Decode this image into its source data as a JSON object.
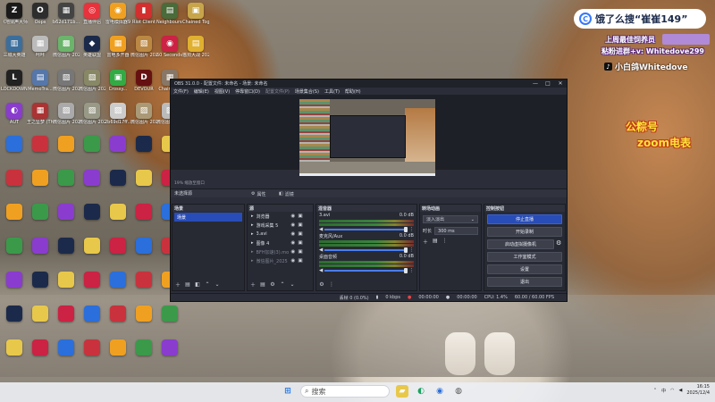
{
  "desktop": {
    "icons": [
      {
        "label": "《地狱声大师》",
        "glyph": "Z",
        "color": "#1a1a1a"
      },
      {
        "label": "Oops",
        "glyph": "O",
        "color": "#2d2d2d"
      },
      {
        "label": "b62d171b...",
        "glyph": "▦",
        "color": "#444"
      },
      {
        "label": "直播伴侣",
        "glyph": "◎",
        "color": "#e8323c"
      },
      {
        "label": "雷电模拟器9",
        "glyph": "◉",
        "color": "#f0a020"
      },
      {
        "label": "Riot Client",
        "glyph": "▮",
        "color": "#d32f2f"
      },
      {
        "label": "Neighbours back From...",
        "glyph": "▤",
        "color": "#4a6b3a"
      },
      {
        "label": "Chained Together",
        "glyph": "▣",
        "color": "#c7a54a"
      },
      {
        "label": "三城大英雄",
        "glyph": "▥",
        "color": "#3c6e9c"
      },
      {
        "label": "咔咔",
        "glyph": "▦",
        "color": "#bbb"
      },
      {
        "label": "微信图片 2025-08...",
        "glyph": "▩",
        "color": "#6bb46b"
      },
      {
        "label": "英雄联盟",
        "glyph": "◆",
        "color": "#1b2a4a"
      },
      {
        "label": "雷电多开器",
        "glyph": "▦",
        "color": "#f0a020"
      },
      {
        "label": "微信图片 2025101...",
        "glyph": "▧",
        "color": "#b84"
      },
      {
        "label": "60 Seconds! Reatomized",
        "glyph": "◉",
        "color": "#c24"
      },
      {
        "label": "猫狗大战 2025090...",
        "glyph": "▤",
        "color": "#e0b030"
      },
      {
        "label": "LOCKDOWN Protocol",
        "glyph": "L",
        "color": "#222"
      },
      {
        "label": "MemoTra...",
        "glyph": "▤",
        "color": "#5577aa"
      },
      {
        "label": "微信图片 20250...",
        "glyph": "▧",
        "color": "#777"
      },
      {
        "label": "微信图片 20250...",
        "glyph": "▧",
        "color": "#886"
      },
      {
        "label": "Crossy...",
        "glyph": "▣",
        "color": "#3a4"
      },
      {
        "label": "DEVOUR",
        "glyph": "D",
        "color": "#611"
      },
      {
        "label": "Chained...",
        "glyph": "▦",
        "color": "#876"
      },
      {
        "label": "",
        "glyph": "",
        "color": "#0000"
      },
      {
        "label": "AUT",
        "glyph": "◐",
        "color": "#8a3ccf"
      },
      {
        "label": "王之坠梦 (The King...",
        "glyph": "▦",
        "color": "#a33"
      },
      {
        "label": "微信图片 2025091...",
        "glyph": "▨",
        "color": "#aaa"
      },
      {
        "label": "微信图片 2025091...",
        "glyph": "▨",
        "color": "#998"
      },
      {
        "label": "2b69d17ff...",
        "glyph": "▨",
        "color": "#ccc"
      },
      {
        "label": "微信图片 20250...",
        "glyph": "▨",
        "color": "#a97"
      },
      {
        "label": "微信图片 20250...",
        "glyph": "▨",
        "color": "#bbb"
      },
      {
        "label": "微信图片 20250...",
        "glyph": "▨",
        "color": "#999"
      }
    ],
    "overlays": {
      "baidu_text": "饿了么搜“崔崔149”",
      "baidu_logo": "C",
      "promo_line1": "上周最佳饲养员",
      "promo_line2": "粘粉进群+v: Whitedove299",
      "douyin_id": "小白鸽Whitedove",
      "douyin_logo": "♪",
      "gzh_line1": "公粽号",
      "gzh_line2": "zoom电表"
    }
  },
  "obs": {
    "title": "OBS 31.0.0 - 配置文件: 未命名 - 场景: 未命名",
    "window_controls": [
      "—",
      "□",
      "✕"
    ],
    "menu": [
      "文件(F)",
      "编辑(E)",
      "视图(V)",
      "停靠窗口(D)",
      "配置文件(P)",
      "场景集合(S)",
      "工具(T)",
      "帮助(H)"
    ],
    "zoom_text": "19%  缩放至窗口",
    "source_bar": {
      "none_selected": "未选择源",
      "properties": "属性",
      "filters": "滤镜"
    },
    "scenes": {
      "header": "场景",
      "items": [
        "场景"
      ]
    },
    "sources": {
      "header": "源",
      "items": [
        {
          "name": "浏览器",
          "dim": false
        },
        {
          "name": "游戏采集 5",
          "dim": false
        },
        {
          "name": "3.avi",
          "dim": false
        },
        {
          "name": "图像 4",
          "dim": false
        },
        {
          "name": "BFH加速(3).mov",
          "dim": true
        },
        {
          "name": "微信图片_2025",
          "dim": true
        }
      ]
    },
    "mixer": {
      "header": "混音器",
      "channels": [
        {
          "name": "3.avi",
          "db": "0.0 dB"
        },
        {
          "name": "麦克风/Aux",
          "db": "0.0 dB"
        },
        {
          "name": "桌面音频",
          "db": "0.0 dB"
        }
      ]
    },
    "transitions": {
      "header": "转场动画",
      "selected": "淡入淡出",
      "duration_label": "时长",
      "duration_value": "300 ms"
    },
    "controls": {
      "header": "控制按钮",
      "stop_stream": "停止直播",
      "start_record": "开始录制",
      "virtual_cam": "启动虚拟摄像机",
      "studio_mode": "工作室模式",
      "settings": "设置",
      "exit": "退出"
    },
    "status": {
      "dropped": "丢帧 0 (0.0%)",
      "kbps": "0 kbps",
      "time1": "00:00:00",
      "time2": "00:00:00",
      "cpu": "CPU: 1.4%",
      "fps": "60.00 / 60.00 FPS"
    }
  },
  "taskbar": {
    "search_placeholder": "搜索",
    "clock_time": "16:15",
    "clock_date": "2025/12/4",
    "lang": "中"
  },
  "colors": {
    "accent": "#284cb8",
    "obs_bg": "#2b2e38"
  }
}
